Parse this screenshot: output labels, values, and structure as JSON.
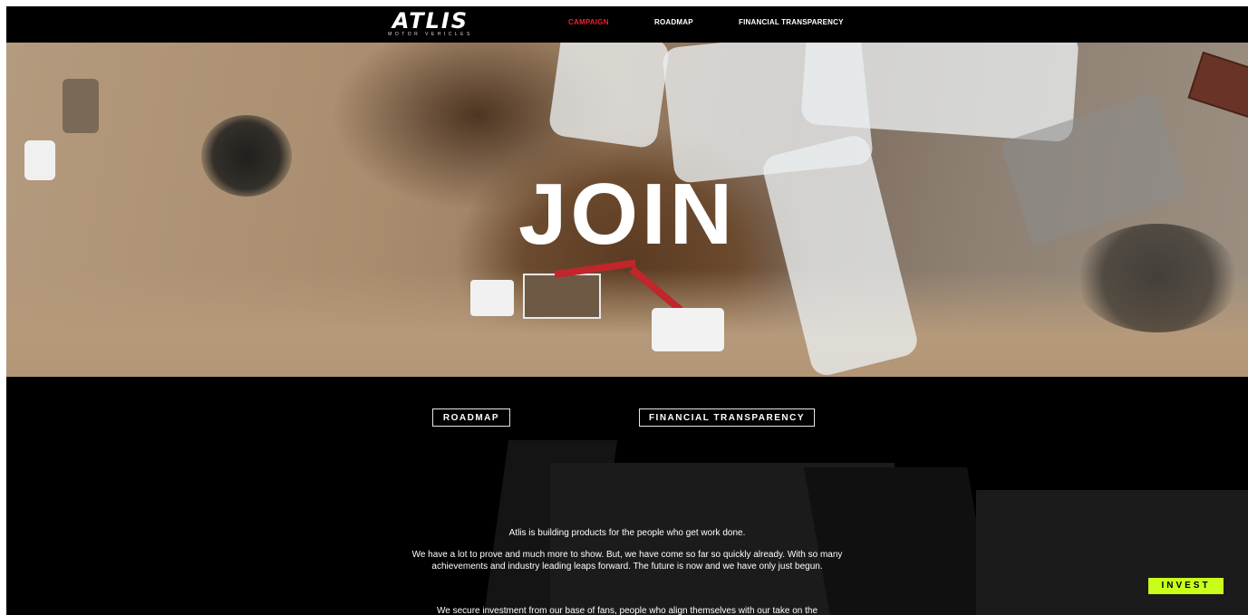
{
  "nav": {
    "logo_text": "ATLIS",
    "logo_subtext": "MOTOR VEHICLES",
    "links": [
      {
        "label": "CAMPAIGN",
        "active": true
      },
      {
        "label": "ROADMAP",
        "active": false
      },
      {
        "label": "FINANCIAL TRANSPARENCY",
        "active": false
      }
    ]
  },
  "hero": {
    "title": "JOIN"
  },
  "buttons": {
    "roadmap": "ROADMAP",
    "financial": "FINANCIAL TRANSPARENCY",
    "invest": "INVEST"
  },
  "content": {
    "p1": "Atlis is building products for the people who get work done.",
    "p2": "We have a lot to prove and much more to show. But, we have come so far so quickly already. With so many achievements and industry leading leaps forward. The future is now and we have only just begun.",
    "p3": "We secure investment from our base of fans, people who align themselves with our take on the"
  },
  "colors": {
    "accent": "#e8242c",
    "invest": "#c8ff1a",
    "background": "#000000"
  }
}
